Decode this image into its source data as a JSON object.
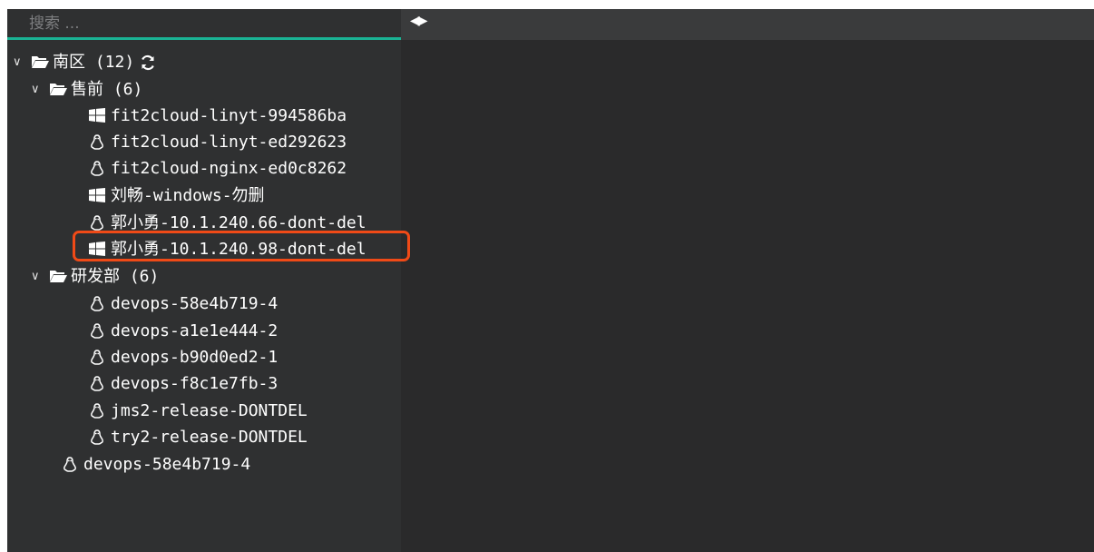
{
  "search": {
    "placeholder": "搜索 ..."
  },
  "splitter": {
    "toggle_icon": "collapse-expand-icon"
  },
  "tree": {
    "groups": [
      {
        "label": "南区 (12)",
        "icon": "folder-open-icon"
      },
      {
        "label": "售前 (6)",
        "icon": "folder-open-icon"
      },
      {
        "label": "研发部 (6)",
        "icon": "folder-open-icon"
      }
    ],
    "hosts": [
      {
        "label": "fit2cloud-linyt-994586ba",
        "os": "windows"
      },
      {
        "label": "fit2cloud-linyt-ed292623",
        "os": "linux"
      },
      {
        "label": "fit2cloud-nginx-ed0c8262",
        "os": "linux"
      },
      {
        "label": "刘畅-windows-勿删",
        "os": "windows"
      },
      {
        "label": "郭小勇-10.1.240.66-dont-del",
        "os": "linux"
      },
      {
        "label": "郭小勇-10.1.240.98-dont-del",
        "os": "windows"
      },
      {
        "label": "devops-58e4b719-4",
        "os": "linux"
      },
      {
        "label": "devops-a1e1e444-2",
        "os": "linux"
      },
      {
        "label": "devops-b90d0ed2-1",
        "os": "linux"
      },
      {
        "label": "devops-f8c1e7fb-3",
        "os": "linux"
      },
      {
        "label": "jms2-release-DONTDEL",
        "os": "linux"
      },
      {
        "label": "try2-release-DONTDEL",
        "os": "linux"
      },
      {
        "label": "devops-58e4b719-4",
        "os": "linux"
      }
    ]
  },
  "colors": {
    "accent": "#1ab394",
    "highlight": "#f04a17",
    "sidebar_bg": "#2f3031",
    "terminal_bg": "#2a2a2b"
  }
}
